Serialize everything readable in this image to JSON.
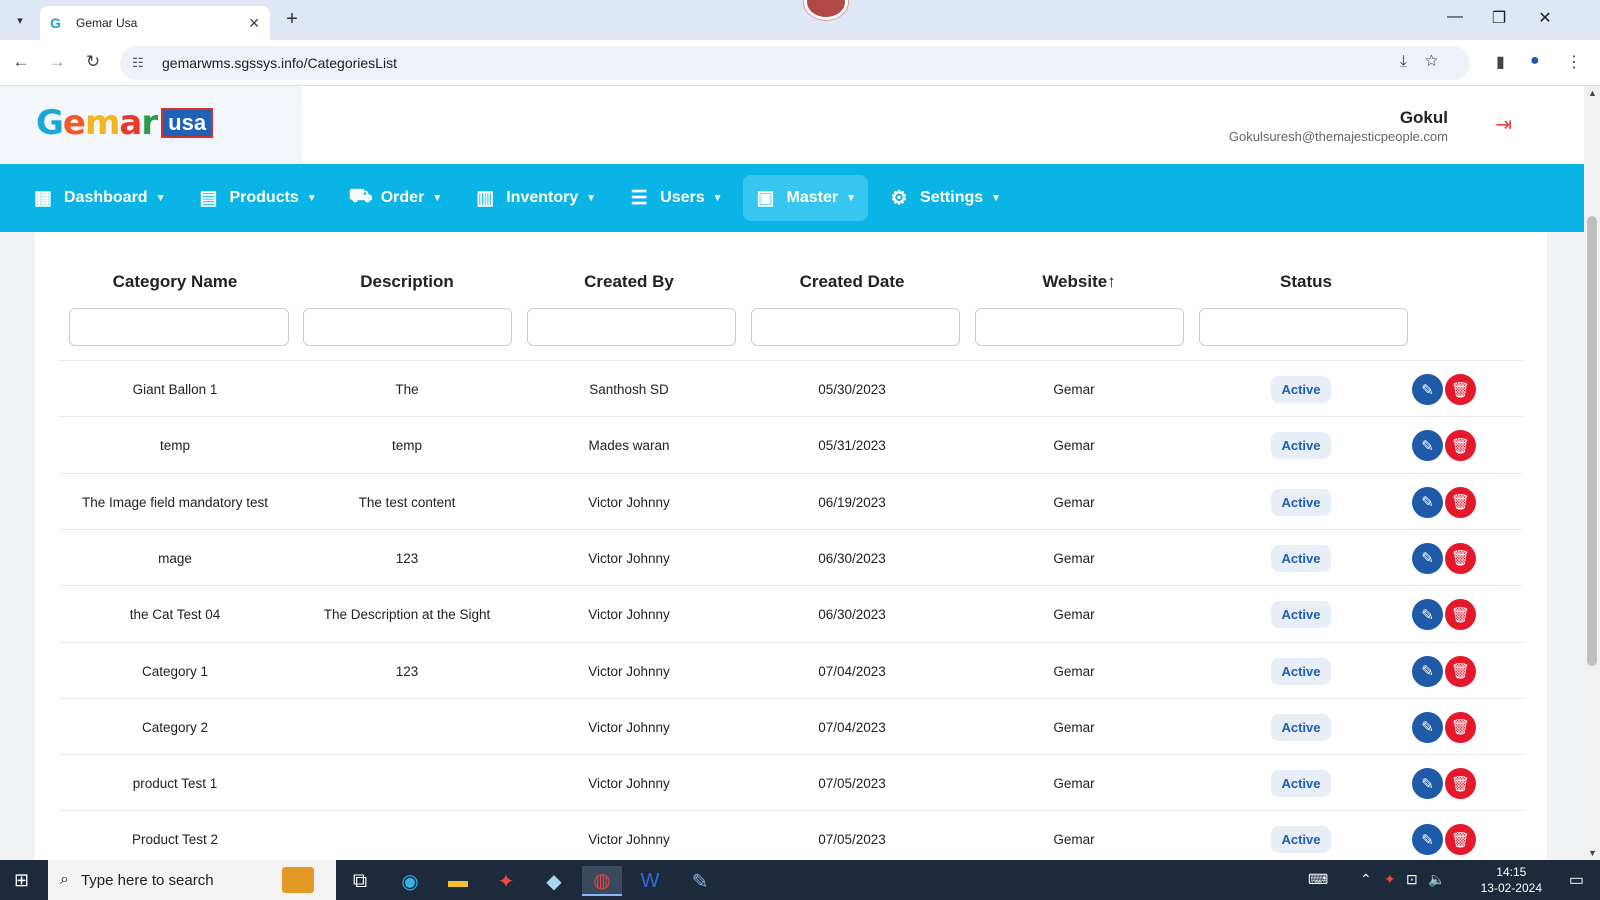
{
  "browser": {
    "tab_title": "Gemar Usa",
    "url": "gemarwms.sgssys.info/CategoriesList",
    "tab_close": "✕",
    "new_tab": "+"
  },
  "header": {
    "logo_text": "Gemar",
    "logo_badge": "usa",
    "user_name": "Gokul",
    "user_email": "Gokulsuresh@themajesticpeople.com"
  },
  "nav": {
    "items": [
      {
        "label": "Dashboard",
        "icon": "dashboard-icon"
      },
      {
        "label": "Products",
        "icon": "products-icon"
      },
      {
        "label": "Order",
        "icon": "cart-icon"
      },
      {
        "label": "Inventory",
        "icon": "inventory-icon"
      },
      {
        "label": "Users",
        "icon": "users-icon"
      },
      {
        "label": "Master",
        "icon": "master-icon",
        "active": true
      },
      {
        "label": "Settings",
        "icon": "settings-icon"
      }
    ]
  },
  "table": {
    "columns": [
      "Category Name",
      "Description",
      "Created By",
      "Created Date",
      "Website",
      "Status"
    ],
    "sort_indicator": "↑",
    "rows": [
      {
        "name": "Giant Ballon 1",
        "description": "The",
        "created_by": "Santhosh SD",
        "date": "05/30/2023",
        "website": "Gemar",
        "status": "Active"
      },
      {
        "name": "temp",
        "description": "temp",
        "created_by": "Mades waran",
        "date": "05/31/2023",
        "website": "Gemar",
        "status": "Active"
      },
      {
        "name": "The Image field mandatory test",
        "description": "The test content",
        "created_by": "Victor Johnny",
        "date": "06/19/2023",
        "website": "Gemar",
        "status": "Active"
      },
      {
        "name": "mage",
        "description": "123",
        "created_by": "Victor Johnny",
        "date": "06/30/2023",
        "website": "Gemar",
        "status": "Active"
      },
      {
        "name": "the Cat Test 04",
        "description": "The Description at the Sight",
        "created_by": "Victor Johnny",
        "date": "06/30/2023",
        "website": "Gemar",
        "status": "Active"
      },
      {
        "name": "Category 1",
        "description": "123",
        "created_by": "Victor Johnny",
        "date": "07/04/2023",
        "website": "Gemar",
        "status": "Active"
      },
      {
        "name": "Category 2",
        "description": "",
        "created_by": "Victor Johnny",
        "date": "07/04/2023",
        "website": "Gemar",
        "status": "Active"
      },
      {
        "name": "product Test 1",
        "description": "",
        "created_by": "Victor Johnny",
        "date": "07/05/2023",
        "website": "Gemar",
        "status": "Active"
      },
      {
        "name": "Product Test 2",
        "description": "",
        "created_by": "Victor Johnny",
        "date": "07/05/2023",
        "website": "Gemar",
        "status": "Active"
      }
    ]
  },
  "taskbar": {
    "search_placeholder": "Type here to search",
    "time": "14:15",
    "date": "13-02-2024"
  }
}
